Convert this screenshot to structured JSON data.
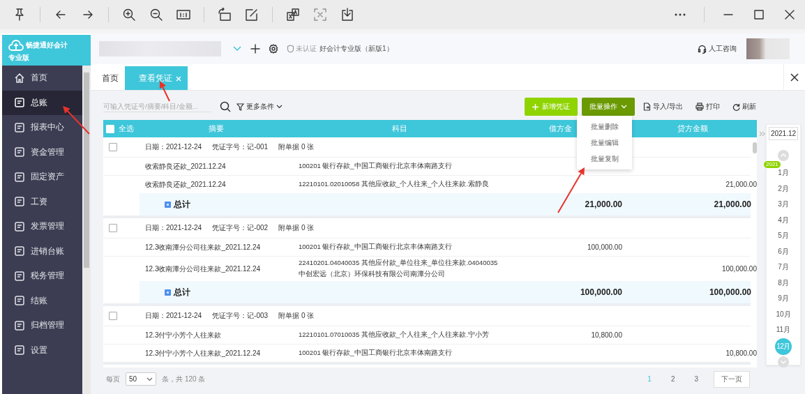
{
  "app_header": {
    "logo_title": "畅捷通好会计",
    "logo_edition": "专业版",
    "certification": "未认证",
    "product": "好会计专业版（新版1）",
    "support": "人工咨询"
  },
  "sidebar": {
    "items": [
      {
        "label": "首页",
        "selected": false
      },
      {
        "label": "总账",
        "selected": true
      },
      {
        "label": "报表中心",
        "selected": false
      },
      {
        "label": "资金管理",
        "selected": false
      },
      {
        "label": "固定资产",
        "selected": false
      },
      {
        "label": "工资",
        "selected": false
      },
      {
        "label": "发票管理",
        "selected": false
      },
      {
        "label": "进销台账",
        "selected": false
      },
      {
        "label": "税务管理",
        "selected": false
      },
      {
        "label": "结账",
        "selected": false
      },
      {
        "label": "归档管理",
        "selected": false
      },
      {
        "label": "设置",
        "selected": false
      }
    ]
  },
  "tabs": [
    {
      "label": "首页",
      "selected": false,
      "closable": false
    },
    {
      "label": "查看凭证",
      "selected": true,
      "closable": true
    }
  ],
  "toolbar": {
    "search_placeholder": "可输入凭证号/摘要/科目/金额...",
    "filter": "更多条件",
    "buttons": [
      {
        "label": "新增凭证",
        "kind": "add"
      },
      {
        "label": "批量操作",
        "kind": "batch"
      },
      {
        "label": "导入/导出",
        "kind": "import"
      },
      {
        "label": "打印",
        "kind": "print"
      },
      {
        "label": "刷新",
        "kind": "refresh"
      }
    ]
  },
  "batch_menu": {
    "items": [
      "批量删除",
      "批量编辑",
      "批量复制"
    ]
  },
  "table": {
    "columns": [
      {
        "label": "全选",
        "kind": "select",
        "checked": false
      },
      {
        "label": "摘要",
        "kind": "text"
      },
      {
        "label": "科目",
        "kind": "text"
      },
      {
        "label": "借方金",
        "kind": "amount"
      },
      {
        "label": "贷方金额",
        "kind": "amount"
      }
    ],
    "vouchers": [
      {
        "selected": false,
        "date": "日期：2021-12-24",
        "number": "凭证字号：记-001",
        "attachments": "附单据 0 张",
        "entries": [
          {
            "summary": "收索静良还款_2021.12.24",
            "account": [
              "100201 银行存款_中国工商银行北京丰体南路支行"
            ]
          },
          {
            "summary": "收索静良还款_2021.12.24",
            "account": [
              "12210101.02010058 其他应收款_个人往来_个人往来款.索静良"
            ],
            "credit": "21,000.00"
          }
        ],
        "total": {
          "label": "总计",
          "debit": "21,000.00",
          "credit": "21,000.00"
        }
      },
      {
        "selected": false,
        "date": "日期：2021-12-24",
        "number": "凭证字号：记-002",
        "attachments": "附单据 0 张",
        "entries": [
          {
            "summary": "12.3收南潭分公司往来款_2021.12.24",
            "account": [
              "100201 银行存款_中国工商银行北京丰体南路支行"
            ],
            "debit": "100,000.00"
          },
          {
            "summary": "12.3收南潭分公司往来款_2021.12.24",
            "account": [
              "22410201.04040035 其他应付款_单位往来_单位往来款.04040035",
              "中创宏远（北京）环保科技有限公司南潭分公司"
            ],
            "credit": "100,000.00"
          }
        ],
        "total": {
          "label": "总计",
          "debit": "100,000.00",
          "credit": "100,000.00"
        }
      },
      {
        "selected": false,
        "date": "日期：2021-12-24",
        "number": "凭证字号：记-003",
        "attachments": "附单据 0 张",
        "entries": [
          {
            "summary": "12.3付宁小芳个人往来款",
            "account": [
              "12210101.07010035 其他应收款_个人往来_个人往来款.宁小芳"
            ],
            "debit": "10,800.00"
          },
          {
            "summary": "12.3付宁小芳个人往来款_2021.12.24",
            "account": [
              "100201 银行存款_中国工商银行北京丰体南路支行"
            ],
            "credit": "10,800.00"
          }
        ]
      }
    ]
  },
  "pagination": {
    "per_page_label": "每页",
    "per_page": "50",
    "total": "条，共 120 条",
    "pages": [
      {
        "label": "1",
        "selected": true
      },
      {
        "label": "2",
        "selected": false
      },
      {
        "label": "3",
        "selected": false
      }
    ],
    "next": "下一页"
  },
  "calendar": {
    "period": "2021.12",
    "year": "2021",
    "months": [
      {
        "label": "1月",
        "selected": false
      },
      {
        "label": "2月",
        "selected": false
      },
      {
        "label": "3月",
        "selected": false
      },
      {
        "label": "4月",
        "selected": false
      },
      {
        "label": "5月",
        "selected": false
      },
      {
        "label": "6月",
        "selected": false
      },
      {
        "label": "7月",
        "selected": false
      },
      {
        "label": "8月",
        "selected": false
      },
      {
        "label": "9月",
        "selected": false
      },
      {
        "label": "10月",
        "selected": false
      },
      {
        "label": "11月",
        "selected": false
      },
      {
        "label": "12月",
        "selected": true
      }
    ]
  }
}
